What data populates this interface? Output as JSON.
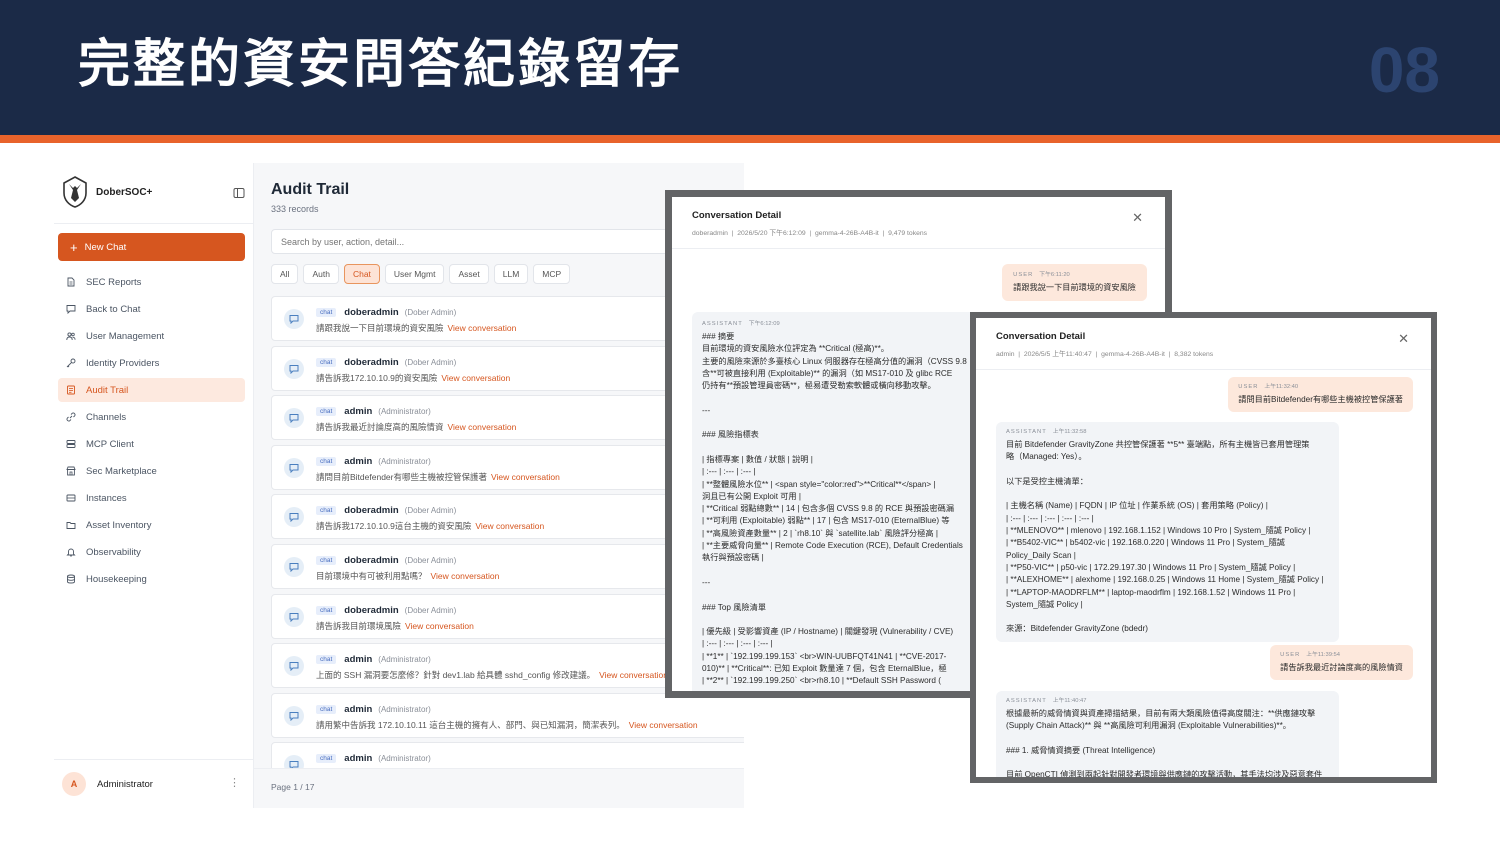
{
  "slide": {
    "title": "完整的資安問答紀錄留存",
    "number": "08"
  },
  "colors": {
    "banner": "#1b2a47",
    "stripe": "#e8632b",
    "accent": "#d6561f",
    "user_bubble": "#fde8dc",
    "assistant_bubble": "#f2f4f7"
  },
  "sidebar": {
    "brand": "DoberSOC+",
    "new_chat": "New Chat",
    "items": [
      {
        "label": "SEC Reports",
        "icon": "document-icon"
      },
      {
        "label": "Back to Chat",
        "icon": "chat-bubble-icon"
      },
      {
        "label": "User Management",
        "icon": "users-icon"
      },
      {
        "label": "Identity Providers",
        "icon": "key-icon"
      },
      {
        "label": "Audit Trail",
        "icon": "audit-log-icon",
        "active": true
      },
      {
        "label": "Channels",
        "icon": "link-icon"
      },
      {
        "label": "MCP Client",
        "icon": "server-icon"
      },
      {
        "label": "Sec Marketplace",
        "icon": "store-icon"
      },
      {
        "label": "Instances",
        "icon": "instances-icon"
      },
      {
        "label": "Asset Inventory",
        "icon": "folder-icon"
      },
      {
        "label": "Observability",
        "icon": "bell-icon"
      },
      {
        "label": "Housekeeping",
        "icon": "database-icon"
      }
    ],
    "user": {
      "initial": "A",
      "name": "Administrator"
    }
  },
  "main": {
    "title": "Audit Trail",
    "subtitle": "333 records",
    "search_placeholder": "Search by user, action, detail...",
    "filters": [
      {
        "label": "All"
      },
      {
        "label": "Auth"
      },
      {
        "label": "Chat",
        "active": true
      },
      {
        "label": "User Mgmt"
      },
      {
        "label": "Asset"
      },
      {
        "label": "LLM"
      },
      {
        "label": "MCP"
      }
    ],
    "link_label": "View conversation",
    "records": [
      {
        "badge": "chat",
        "user": "doberadmin",
        "role": "(Dober Admin)",
        "message": "請跟我說一下目前環境的資安風險"
      },
      {
        "badge": "chat",
        "user": "doberadmin",
        "role": "(Dober Admin)",
        "message": "請告訴我172.10.10.9的資安風險"
      },
      {
        "badge": "chat",
        "user": "admin",
        "role": "(Administrator)",
        "message": "請告訴我最近討論度高的風險情資"
      },
      {
        "badge": "chat",
        "user": "admin",
        "role": "(Administrator)",
        "message": "請問目前Bitdefender有哪些主機被控管保護著"
      },
      {
        "badge": "chat",
        "user": "doberadmin",
        "role": "(Dober Admin)",
        "message": "請告訴我172.10.10.9這台主機的資安風險"
      },
      {
        "badge": "chat",
        "user": "doberadmin",
        "role": "(Dober Admin)",
        "message": "目前環境中有可被利用點嗎？"
      },
      {
        "badge": "chat",
        "user": "doberadmin",
        "role": "(Dober Admin)",
        "message": "請告訴我目前環境風險"
      },
      {
        "badge": "chat",
        "user": "admin",
        "role": "(Administrator)",
        "message": "上面的 SSH 漏洞要怎麼修？針對 dev1.lab 給具體 sshd_config 修改建議。"
      },
      {
        "badge": "chat",
        "user": "admin",
        "role": "(Administrator)",
        "message": "請用繁中告訴我 172.10.10.11 這台主機的擁有人、部門、與已知漏洞，簡潔表列。"
      },
      {
        "badge": "chat",
        "user": "admin",
        "role": "(Administrator)",
        "message": ""
      }
    ],
    "pagination": "Page 1 / 17"
  },
  "conversation_a": {
    "title": "Conversation Detail",
    "meta": [
      "doberadmin",
      "2026/5/20 下午6:12:09",
      "gemma-4-26B-A4B-it",
      "9,479 tokens"
    ],
    "user_msg": {
      "role": "USER",
      "time": "下午6:11:20",
      "text": "請跟我說一下目前環境的資安風險"
    },
    "assistant": {
      "role": "ASSISTANT",
      "time": "下午6:12:09",
      "lines": [
        "### 摘要",
        "目前環境的資安風險水位評定為 **Critical (極高)**。",
        "主要的風險來源於多臺核心 Linux 伺服器存在極高分值的漏洞（CVSS 9.8",
        "含**可被直接利用 (Exploitable)** 的漏洞（如 MS17-010 及 glibc RCE",
        "仍持有**預設管理員密碼**，極易遭受勒索軟體或橫向移動攻擊。",
        "",
        "---",
        "",
        "### 風險指標表",
        "",
        "| 指標專案 | 數值 / 狀態 | 說明 |",
        "| :--- | :--- | :--- |",
        "| **整體風險水位** | <span style=\"color:red\">**Critical**</span> |",
        "洞且已有公開 Exploit 可用 |",
        "| **Critical 弱點總數** | 14 | 包含多個 CVSS 9.8 的 RCE 與預設密碼漏",
        "| **可利用 (Exploitable) 弱點** | 17 | 包含 MS17-010 (EternalBlue) 等",
        "| **高風險資產數量** | 2 | `rh8.10` 與 `satellite.lab` 風險評分極高 |",
        "| **主要威脅向量** | Remote Code Execution (RCE), Default Credentials",
        "執行與預設密碼 |",
        "",
        "---",
        "",
        "### Top 風險清單",
        "",
        "| 優先級 | 受影響資產 (IP / Hostname) | 關鍵發現 (Vulnerability / CVE)",
        "| :--- | :--- | :--- | :--- |",
        "| **1** | `192.199.199.153` <br>WIN-UUBFQT41N41 | **CVE-2017-",
        "010)** | **Critical**: 已知 Exploit 數量達 7 個，包含 EternalBlue，極",
        "| **2** | `192.199.199.250` <br>rh8.10 | **Default SSH Password ("
      ]
    }
  },
  "conversation_b": {
    "title": "Conversation Detail",
    "meta": [
      "admin",
      "2026/5/5 上午11:40:47",
      "gemma-4-26B-A4B-it",
      "8,382 tokens"
    ],
    "user_msg_1": {
      "role": "USER",
      "time": "上午11:32:40",
      "text": "請問目前Bitdefender有哪些主機被控管保護著"
    },
    "assistant_1": {
      "role": "ASSISTANT",
      "time": "上午11:32:58",
      "lines": [
        "目前 Bitdefender GravityZone 共控管保護著 **5** 臺端點，所有主機皆已套用管理策",
        "略（Managed: Yes）。",
        "",
        "以下是受控主機清單：",
        "",
        "| 主機名稱 (Name) | FQDN | IP 位址 | 作業系統 (OS) | 套用策略 (Policy) |",
        "| :--- | :--- | :--- | :--- | :--- |",
        "| **MLENOVO** | mlenovo | 192.168.1.152 | Windows 10 Pro | System_隨誠 Policy |",
        "| **B5402-VIC** | b5402-vic | 192.168.0.220 | Windows 11 Pro | System_隨誠",
        "Policy_Daily Scan |",
        "| **P50-VIC** | p50-vic | 172.29.197.30 | Windows 11 Pro | System_隨誠 Policy |",
        "| **ALEXHOME** | alexhome | 192.168.0.25 | Windows 11 Home | System_隨誠 Policy |",
        "| **LAPTOP-MAODRFLM** | laptop-maodrflm | 192.168.1.52 | Windows 11 Pro |",
        "System_隨誠 Policy |",
        "",
        "來源：Bitdefender GravityZone (bdedr)"
      ]
    },
    "user_msg_2": {
      "role": "USER",
      "time": "上午11:39:54",
      "text": "請告訴我最近討論度高的風險情資"
    },
    "assistant_2": {
      "role": "ASSISTANT",
      "time": "上午11:40:47",
      "lines": [
        "根據最新的威脅情資與資產掃描結果，目前有兩大類風險值得高度關注：**供應鏈攻擊",
        "(Supply Chain Attack)** 與 **高風險可利用漏洞 (Exploitable Vulnerabilities)**。",
        "",
        "### 1. 威脅情資摘要 (Threat Intelligence)",
        "",
        "目前 OpenCTI 偵測到兩起針對開發者環境與供應鏈的攻擊活動，其手法均涉及惡意套件"
      ]
    }
  }
}
